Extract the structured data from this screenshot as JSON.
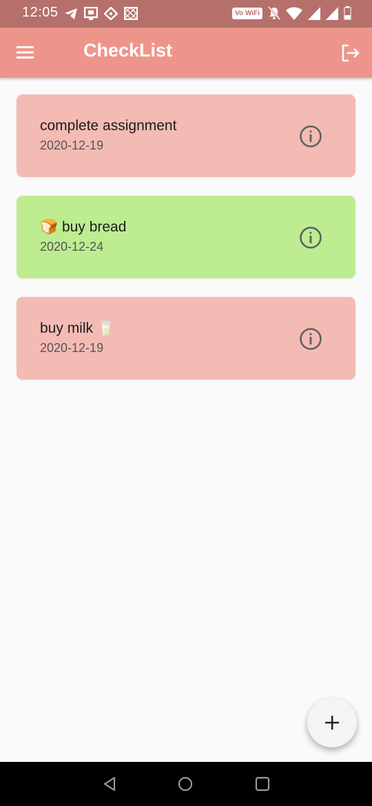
{
  "status_bar": {
    "time": "12:05",
    "wifi_label": "Vo WiFi",
    "icons_left": [
      "telegram-icon",
      "screen-icon",
      "location-icon",
      "crosshatch-icon"
    ],
    "icons_right": [
      "vowifi-icon",
      "mute-icon",
      "wifi-icon",
      "signal-icon",
      "signal-icon",
      "battery-icon"
    ]
  },
  "app_bar": {
    "title": "CheckList",
    "menu_icon": "hamburger-menu-icon",
    "logout_icon": "logout-icon",
    "color": "#ee958b"
  },
  "tasks": [
    {
      "title": "complete assignment",
      "date": "2020-12-19",
      "color": "#f3bbb4",
      "emoji_before": "",
      "emoji_after": ""
    },
    {
      "title": "buy bread",
      "date": "2020-12-24",
      "color": "#bdec91",
      "emoji_before": "🍞",
      "emoji_after": ""
    },
    {
      "title": "buy milk",
      "date": "2020-12-19",
      "color": "#f3bbb4",
      "emoji_before": "",
      "emoji_after": "🥛"
    }
  ],
  "fab": {
    "icon": "plus-icon"
  },
  "nav_bar": {
    "icons": [
      "back-icon",
      "home-icon",
      "recents-icon"
    ]
  }
}
